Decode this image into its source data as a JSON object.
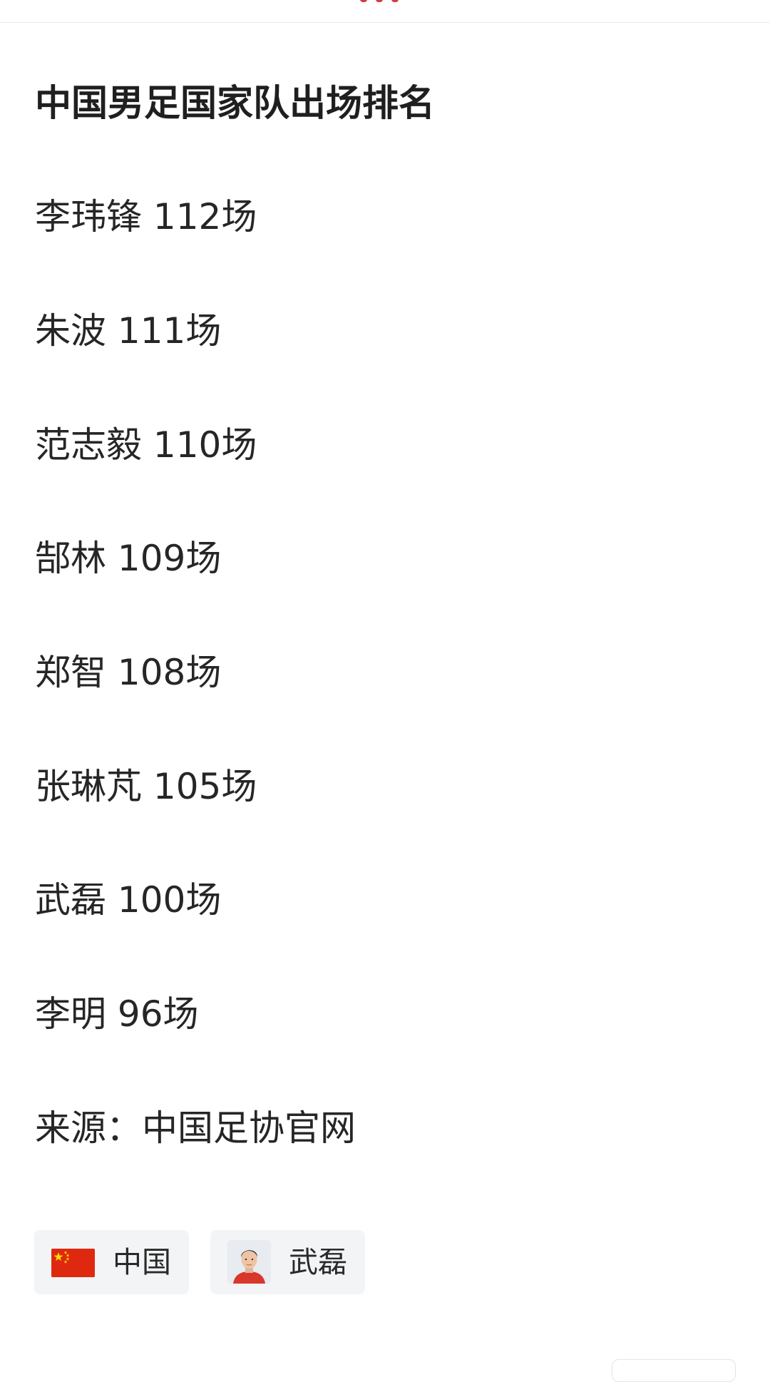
{
  "article": {
    "title": "中国男足国家队出场排名",
    "rankings": [
      {
        "text": "李玮锋 112场"
      },
      {
        "text": "朱波 111场"
      },
      {
        "text": "范志毅 110场"
      },
      {
        "text": "郜林 109场"
      },
      {
        "text": "郑智 108场"
      },
      {
        "text": "张琳芃 105场"
      },
      {
        "text": "武磊 100场"
      },
      {
        "text": "李明 96场"
      }
    ],
    "source": "来源：中国足协官网"
  },
  "tags": [
    {
      "label": "中国",
      "icon": "china-flag-icon"
    },
    {
      "label": "武磊",
      "icon": "player-avatar"
    }
  ],
  "colors": {
    "accent": "#d43c3c",
    "flag_red": "#de2910",
    "flag_star": "#ffde00",
    "tag_bg": "#f3f4f6"
  }
}
